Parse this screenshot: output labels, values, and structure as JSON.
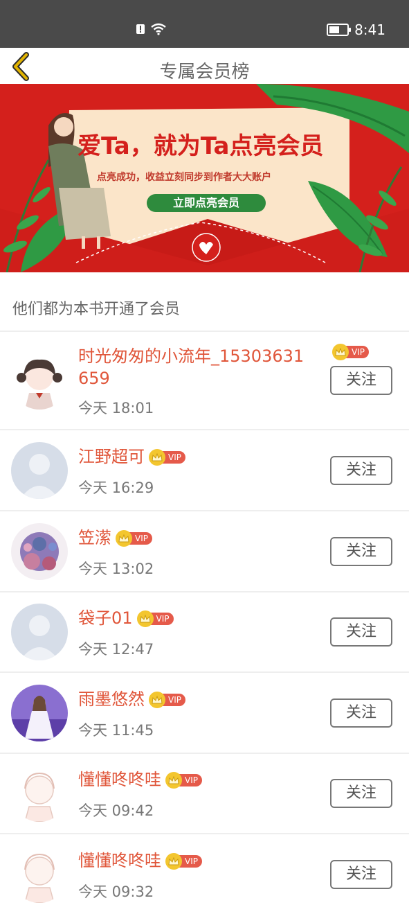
{
  "status_bar": {
    "time": "8:41",
    "battery_level": 0.5,
    "icons": [
      "alert-icon",
      "wifi-icon",
      "battery-icon"
    ]
  },
  "header": {
    "title": "专属会员榜",
    "back_icon": "chevron-left-icon",
    "back_color": "#e1b300"
  },
  "banner": {
    "headline": "爱Ta，就为Ta点亮会员",
    "subtext": "点亮成功，收益立刻同步到作者大大账户",
    "cta": "立即点亮会员",
    "bg_color": "#d4201c",
    "paper_color": "#fbe5c9",
    "cta_color": "#2e8b3d"
  },
  "section_title": "他们都为本书开通了会员",
  "vip_label": "VIP",
  "follow_label": "关注",
  "members": [
    {
      "name": "时光匆匆的小流年_15303631659",
      "time": "今天 18:01",
      "avatar": "anime-girl-avatar"
    },
    {
      "name": "江野超可",
      "time": "今天 16:29",
      "avatar": "default-person-avatar"
    },
    {
      "name": "笠潆",
      "time": "今天 13:02",
      "avatar": "floral-photo-avatar"
    },
    {
      "name": "袋子01",
      "time": "今天 12:47",
      "avatar": "default-person-avatar"
    },
    {
      "name": "雨墨悠然",
      "time": "今天 11:45",
      "avatar": "girl-lavender-avatar"
    },
    {
      "name": "懂懂咚咚哇",
      "time": "今天 09:42",
      "avatar": "sketch-girl-avatar"
    },
    {
      "name": "懂懂咚咚哇",
      "time": "今天 09:32",
      "avatar": "sketch-girl-avatar"
    }
  ],
  "colors": {
    "name": "#e0563a",
    "vip_tag": "#e55a4a",
    "crown": "#f3c62f",
    "status_bar": "#4a4a4a"
  }
}
